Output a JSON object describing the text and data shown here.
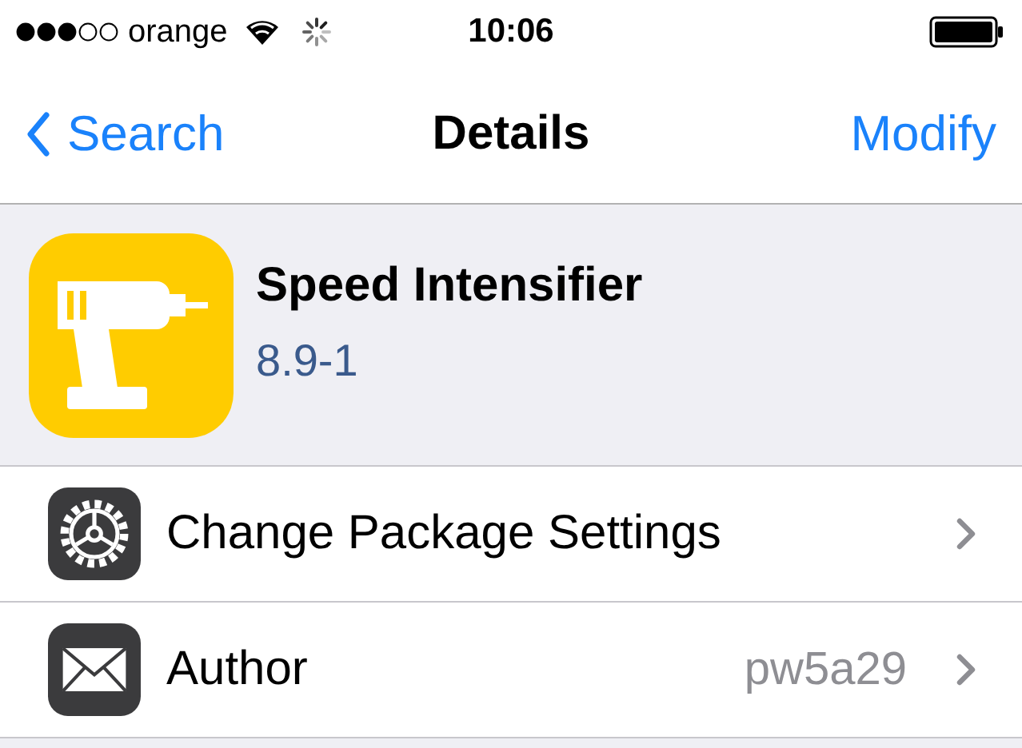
{
  "status_bar": {
    "carrier": "orange",
    "time": "10:06"
  },
  "nav_bar": {
    "back": "Search",
    "title": "Details",
    "action": "Modify"
  },
  "package": {
    "name": "Speed Intensifier",
    "version": "8.9-1"
  },
  "rows": [
    {
      "kind": "settings",
      "label": "Change Package Settings"
    },
    {
      "kind": "author",
      "label": "Author",
      "value": "pw5a29"
    }
  ]
}
